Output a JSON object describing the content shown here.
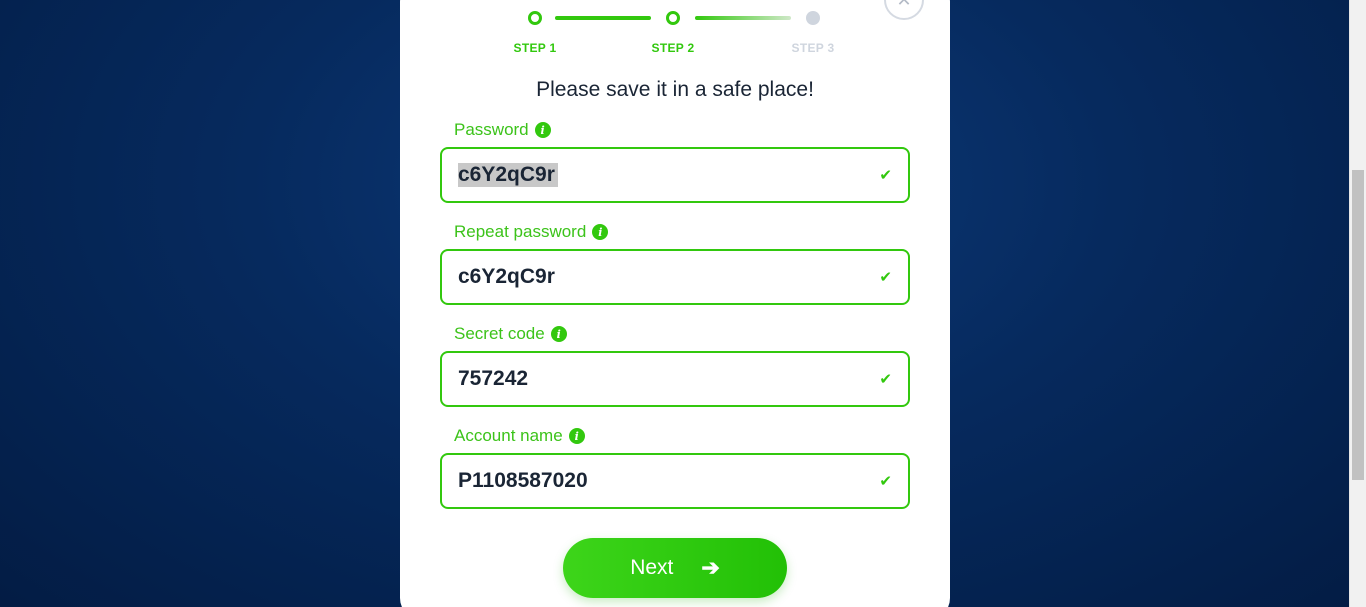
{
  "stepper": {
    "steps": [
      {
        "label": "STEP 1",
        "state": "done"
      },
      {
        "label": "STEP 2",
        "state": "done"
      },
      {
        "label": "STEP 3",
        "state": "todo"
      }
    ]
  },
  "heading": "Please save it in a safe place!",
  "fields": {
    "password": {
      "label": "Password",
      "value": "c6Y2qC9r"
    },
    "repeat_password": {
      "label": "Repeat password",
      "value": "c6Y2qC9r"
    },
    "secret_code": {
      "label": "Secret code",
      "value": "757242"
    },
    "account_name": {
      "label": "Account name",
      "value": "P1108587020"
    }
  },
  "icons": {
    "info": "i",
    "check": "✔",
    "close": "✕",
    "arrow": "➔"
  },
  "buttons": {
    "next_label": "Next"
  },
  "colors": {
    "accent": "#32c80e",
    "text": "#1a2535",
    "inactive": "#cfd5de"
  }
}
